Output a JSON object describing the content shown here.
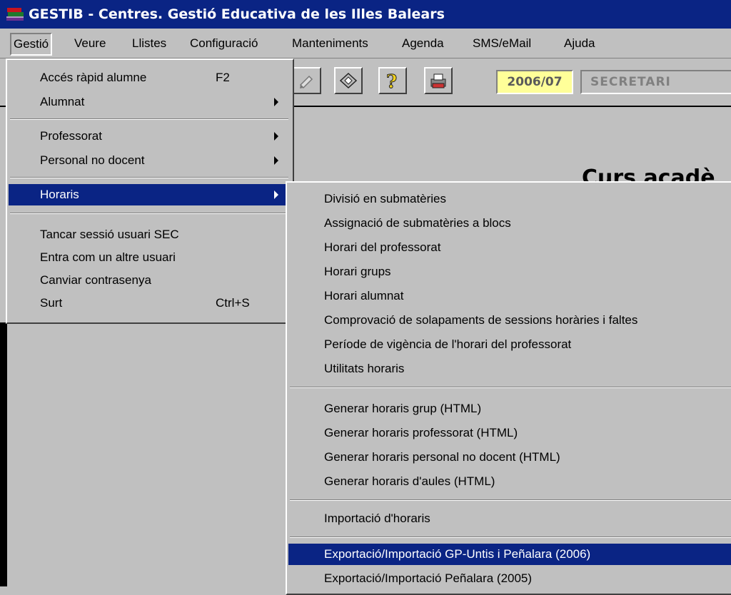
{
  "window": {
    "title": "GESTIB - Centres. Gestió Educativa de les Illes Balears"
  },
  "menubar": [
    {
      "label": "Gestió"
    },
    {
      "label": "Veure"
    },
    {
      "label": "Llistes"
    },
    {
      "label": "Configuració"
    },
    {
      "label": "Manteniments"
    },
    {
      "label": "Agenda"
    },
    {
      "label": "SMS/eMail"
    },
    {
      "label": "Ajuda"
    }
  ],
  "toolbar": {
    "year": "2006/07",
    "user": "SECRETARI"
  },
  "background": {
    "heading": "Curs acadè"
  },
  "gestio_menu": {
    "items": [
      {
        "label": "Accés ràpid alumne",
        "shortcut": "F2"
      },
      {
        "label": "Alumnat"
      },
      {
        "label": "Professorat"
      },
      {
        "label": "Personal no docent"
      },
      {
        "label": "Horaris"
      },
      {
        "label": "Tancar sessió usuari SEC"
      },
      {
        "label": "Entra com un altre usuari"
      },
      {
        "label": "Canviar contrasenya"
      },
      {
        "label": "Surt",
        "shortcut": "Ctrl+S"
      }
    ]
  },
  "horaris_menu": {
    "items": [
      {
        "label": "Divisió en submatèries"
      },
      {
        "label": "Assignació de submatèries a blocs"
      },
      {
        "label": "Horari del professorat"
      },
      {
        "label": "Horari grups"
      },
      {
        "label": "Horari alumnat"
      },
      {
        "label": "Comprovació de solapaments de sessions horàries i faltes"
      },
      {
        "label": "Període de vigència de l'horari del professorat"
      },
      {
        "label": "Utilitats horaris"
      },
      {
        "label": "Generar horaris grup (HTML)"
      },
      {
        "label": "Generar horaris professorat (HTML)"
      },
      {
        "label": "Generar horaris personal no docent (HTML)"
      },
      {
        "label": "Generar horaris d'aules (HTML)"
      },
      {
        "label": "Importació d'horaris"
      },
      {
        "label": "Exportació/Importació GP-Untis i Peñalara (2006)"
      },
      {
        "label": "Exportació/Importació Peñalara (2005)"
      }
    ]
  },
  "colors": {
    "title_bar": "#0a2484",
    "highlight": "#0a2484",
    "face": "#c0c0c0",
    "year_bg": "#ffff99"
  }
}
